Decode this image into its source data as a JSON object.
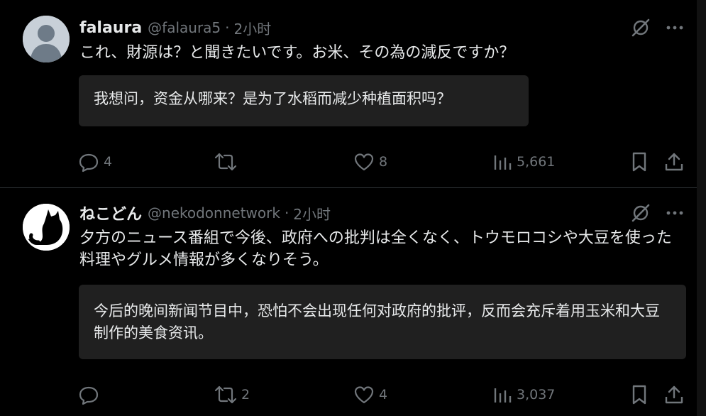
{
  "posts": [
    {
      "display_name": "falaura",
      "handle": "@falaura5",
      "separator": "·",
      "time": "2小时",
      "text": "これ、財源は？と聞きたいです。お米、その為の減反ですか？",
      "translation": "我想问，资金从哪来？是为了水稻而减少种植面积吗？",
      "stats": {
        "replies": "4",
        "reposts": "",
        "likes": "8",
        "views": "5,661"
      },
      "avatar_icon": "default-avatar-icon"
    },
    {
      "display_name": "ねこどん",
      "handle": "@nekodonnetwork",
      "separator": "·",
      "time": "2小时",
      "text": "夕方のニュース番組で今後、政府への批判は全くなく、トウモロコシや大豆を使った料理やグルメ情報が多くなりそう。",
      "translation": "今后的晚间新闻节目中，恐怕不会出现任何对政府的批评，反而会充斥着用玉米和大豆制作的美食资讯。",
      "stats": {
        "replies": "",
        "reposts": "2",
        "likes": "4",
        "views": "3,037"
      },
      "avatar_icon": "black-cat-avatar-icon"
    }
  ],
  "icons": {
    "grok": "grok-slash-icon",
    "more": "more-dots-icon",
    "reply": "reply-icon",
    "repost": "repost-icon",
    "like": "heart-icon",
    "views": "views-chart-icon",
    "bookmark": "bookmark-icon",
    "share": "share-icon"
  },
  "colors": {
    "background": "#000000",
    "text": "#e7e9ea",
    "muted": "#71767b",
    "translation_bg": "#202020",
    "divider": "#2f3336"
  }
}
